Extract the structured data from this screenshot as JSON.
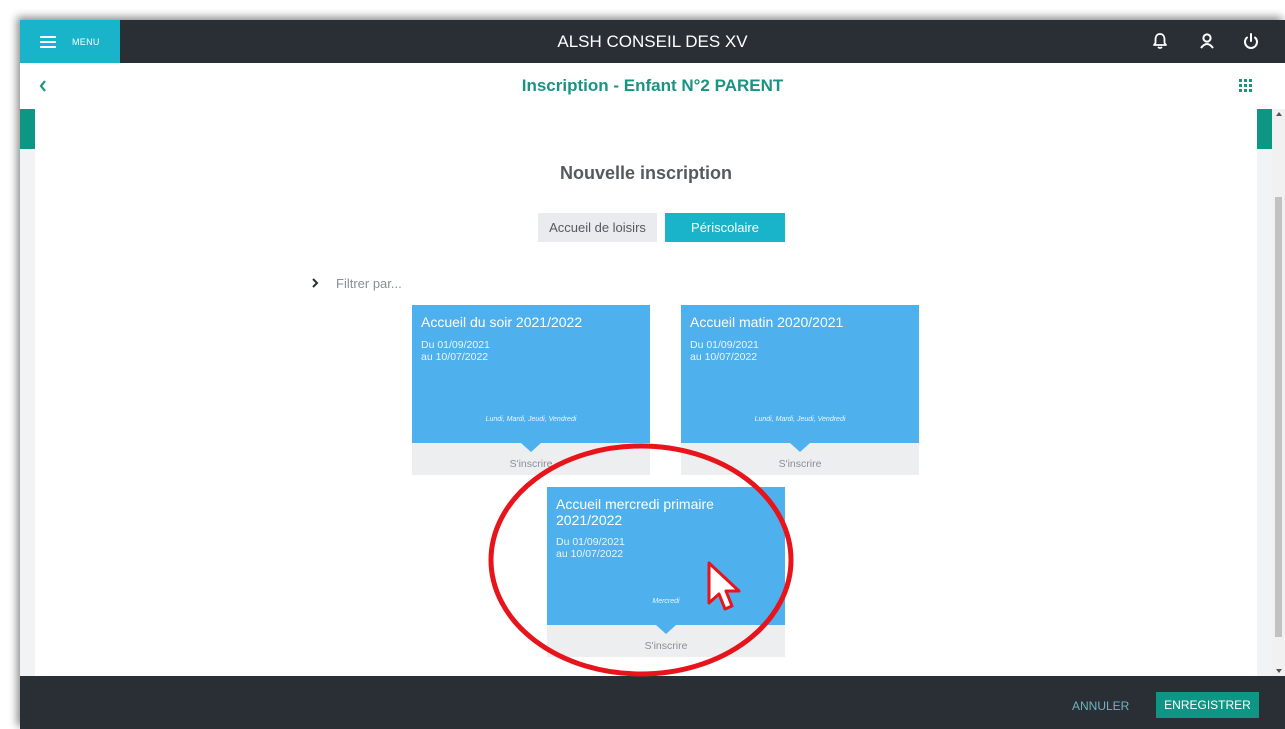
{
  "topbar": {
    "menu_label": "MENU",
    "app_title": "ALSH CONSEIL DES XV",
    "icons": [
      "bell-icon",
      "user-icon",
      "power-icon"
    ]
  },
  "subheader": {
    "page_title": "Inscription  -  Enfant N°2 PARENT",
    "icons": [
      "chevron-left-icon",
      "apps-grid-icon"
    ]
  },
  "main": {
    "section_title": "Nouvelle inscription",
    "tabs": [
      {
        "label": "Accueil de loisirs",
        "active": false
      },
      {
        "label": "Périscolaire",
        "active": true
      }
    ],
    "filter_label": "Filtrer par...",
    "cards": [
      {
        "title": "Accueil du soir 2021/2022",
        "date_from": "Du 01/09/2021",
        "date_to": "au 10/07/2022",
        "days": "Lundi, Mardi, Jeudi, Vendredi",
        "action": "S'inscrire"
      },
      {
        "title": "Accueil matin 2020/2021",
        "date_from": "Du 01/09/2021",
        "date_to": "au 10/07/2022",
        "days": "Lundi, Mardi, Jeudi, Vendredi",
        "action": "S'inscrire"
      },
      {
        "title": "Accueil mercredi primaire 2021/2022",
        "date_from": "Du 01/09/2021",
        "date_to": "au 10/07/2022",
        "days": "Mercredi",
        "action": "S'inscrire"
      }
    ]
  },
  "footer": {
    "cancel_label": "ANNULER",
    "save_label": "ENREGISTRER"
  },
  "colors": {
    "topbar_bg": "#2a2f36",
    "menu_accent": "#19b4c9",
    "brand_green": "#0e9685",
    "card_blue": "#4fb0ee",
    "annotation_red": "#e8141c"
  }
}
